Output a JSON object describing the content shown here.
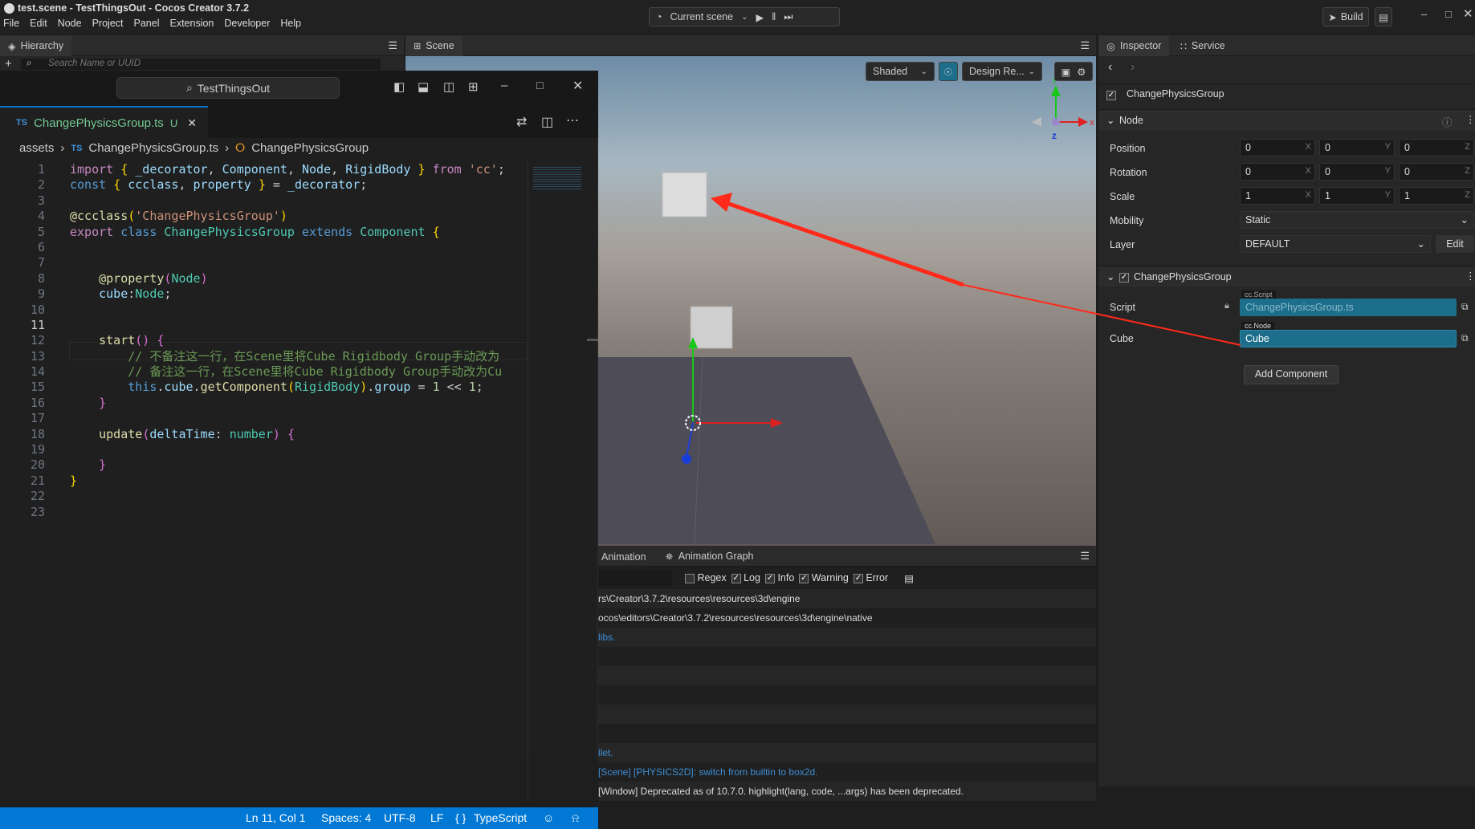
{
  "app": {
    "title": "test.scene - TestThingsOut - Cocos Creator 3.7.2",
    "menu": [
      "File",
      "Edit",
      "Node",
      "Project",
      "Panel",
      "Extension",
      "Developer",
      "Help"
    ],
    "scene_select": "Current scene",
    "build_label": "Build"
  },
  "hierarchy": {
    "tab": "Hierarchy",
    "search_placeholder": "Search Name or UUID"
  },
  "scene": {
    "tab": "Scene",
    "mode_3d": "3D",
    "shading": "Shaded",
    "design": "Design Re...",
    "gizmo": {
      "x": "x",
      "y": "y",
      "z": "z"
    }
  },
  "vscode": {
    "search": "TestThingsOut",
    "tab": {
      "lang": "TS",
      "name": "ChangePhysicsGroup.ts",
      "status": "U"
    },
    "breadcrumb": [
      "assets",
      "ChangePhysicsGroup.ts",
      "ChangePhysicsGroup"
    ],
    "line_numbers": [
      "1",
      "2",
      "3",
      "4",
      "5",
      "6",
      "7",
      "8",
      "9",
      "10",
      "11",
      "12",
      "13",
      "14",
      "15",
      "16",
      "17",
      "18",
      "19",
      "20",
      "21",
      "22",
      "23"
    ],
    "status": {
      "position": "Ln 11, Col 1",
      "spaces": "Spaces: 4",
      "encoding": "UTF-8",
      "eol": "LF",
      "language": "TypeScript"
    }
  },
  "console": {
    "tabs": [
      "Animation",
      "Animation Graph"
    ],
    "filters": [
      "Regex",
      "Log",
      "Info",
      "Warning",
      "Error"
    ],
    "rows": [
      "rs\\Creator\\3.7.2\\resources\\resources\\3d\\engine",
      "ocos\\editors\\Creator\\3.7.2\\resources\\resources\\3d\\engine\\native",
      "libs.",
      "",
      "",
      "",
      "",
      "",
      "llet.",
      "[Scene] [PHYSICS2D]: switch from builtin to box2d.",
      "[Window] Deprecated as of 10.7.0. highlight(lang, code, ...args) has been deprecated."
    ]
  },
  "inspector": {
    "tabs": [
      "Inspector",
      "Service"
    ],
    "node_name": "ChangePhysicsGroup",
    "node_section": "Node",
    "props": {
      "position": {
        "label": "Position",
        "x": "0",
        "y": "0",
        "z": "0"
      },
      "rotation": {
        "label": "Rotation",
        "x": "0",
        "y": "0",
        "z": "0"
      },
      "scale": {
        "label": "Scale",
        "x": "1",
        "y": "1",
        "z": "1"
      },
      "mobility": {
        "label": "Mobility",
        "value": "Static"
      },
      "layer": {
        "label": "Layer",
        "value": "DEFAULT",
        "edit": "Edit"
      }
    },
    "axes": {
      "x": "X",
      "y": "Y",
      "z": "Z"
    },
    "component": {
      "name": "ChangePhysicsGroup",
      "script_label": "Script",
      "script_type": "cc.Script",
      "script_value": "ChangePhysicsGroup.ts",
      "cube_label": "Cube",
      "cube_type": "cc.Node",
      "cube_value": "Cube"
    },
    "add_component": "Add Component"
  },
  "colors": {
    "accent": "#0078d4",
    "annotation_arrow": "#ff2a1a",
    "field_blue": "#1d6e8a"
  }
}
